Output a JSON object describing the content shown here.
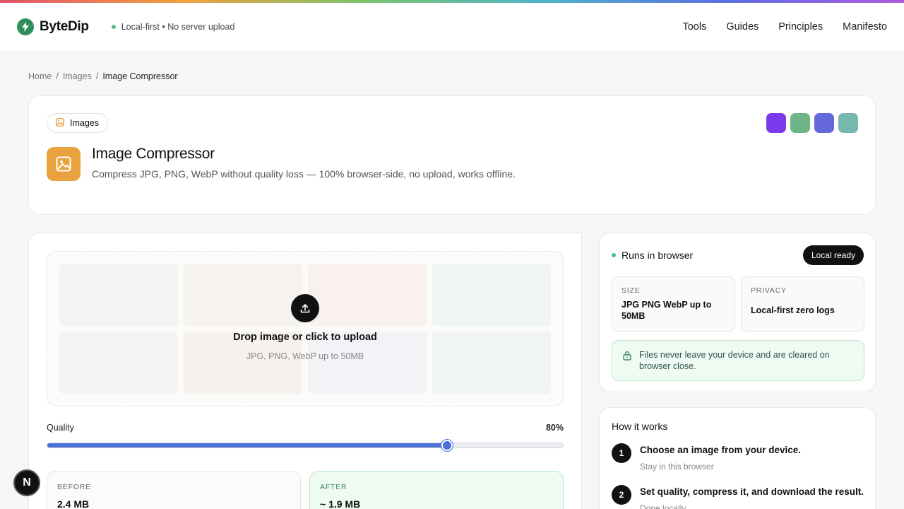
{
  "header": {
    "brand": "ByteDip",
    "status": "Local-first • No server upload",
    "nav": [
      "Tools",
      "Guides",
      "Principles",
      "Manifesto"
    ]
  },
  "breadcrumb": [
    "Home",
    "Images",
    "Image Compressor"
  ],
  "hero": {
    "chip_label": "Images",
    "title": "Image Compressor",
    "subtitle": "Compress JPG, PNG, WebP without quality loss — 100% browser-side, no upload, works offline.",
    "swatch_colors": [
      "#7c3aed",
      "#6fb58a",
      "#6468d8",
      "#74b8ae"
    ]
  },
  "dropzone": {
    "title": "Drop image or click to upload",
    "subtitle": "JPG, PNG, WebP up to 50MB"
  },
  "quality": {
    "label": "Quality",
    "value_text": "80%",
    "fraction": 0.775
  },
  "stats": {
    "before_label": "BEFORE",
    "before_value": "2.4 MB",
    "after_label": "AFTER",
    "after_value": "~ 1.9 MB"
  },
  "side": {
    "runs_label": "Runs in browser",
    "badge": "Local ready",
    "size_label": "SIZE",
    "size_value": "JPG PNG WebP up to 50MB",
    "privacy_label": "PRIVACY",
    "privacy_value": "Local-first zero logs",
    "note": "Files never leave your device and are cleared on browser close."
  },
  "how": {
    "title": "How it works",
    "steps": [
      {
        "num": "1",
        "title": "Choose an image from your device.",
        "sub": "Stay in this browser"
      },
      {
        "num": "2",
        "title": "Set quality, compress it, and download the result.",
        "sub": "Done locally"
      }
    ]
  },
  "dev_badge": "N"
}
